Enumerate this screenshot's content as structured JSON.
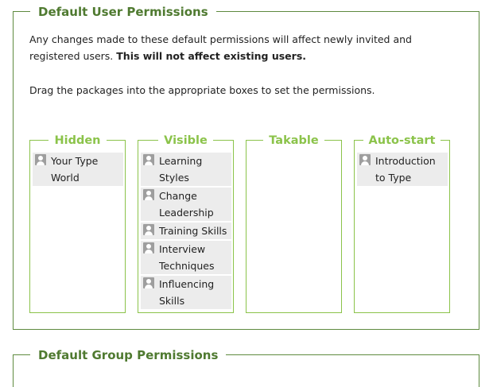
{
  "user_section": {
    "legend": "Default User Permissions",
    "description_text": "Any changes made to these default permissions will affect newly invited and registered users. ",
    "description_bold": "This will not affect existing users.",
    "instruction": "Drag the packages into the appropriate boxes to set the permissions.",
    "boxes": [
      {
        "title": "Hidden",
        "items": [
          "Your Type World"
        ]
      },
      {
        "title": "Visible",
        "items": [
          "Learning Styles",
          "Change Leadership",
          "Training Skills",
          "Interview Techniques",
          "Influencing Skills"
        ]
      },
      {
        "title": "Takable",
        "items": []
      },
      {
        "title": "Auto-start",
        "items": [
          "Introduction to Type"
        ]
      }
    ]
  },
  "group_section": {
    "legend": "Default Group Permissions"
  },
  "icons": {
    "package_icon": "user-icon"
  },
  "colors": {
    "section_border": "#5e8a3f",
    "section_title": "#4f7a30",
    "box_accent": "#8bc34a",
    "item_bg": "#ececec"
  }
}
